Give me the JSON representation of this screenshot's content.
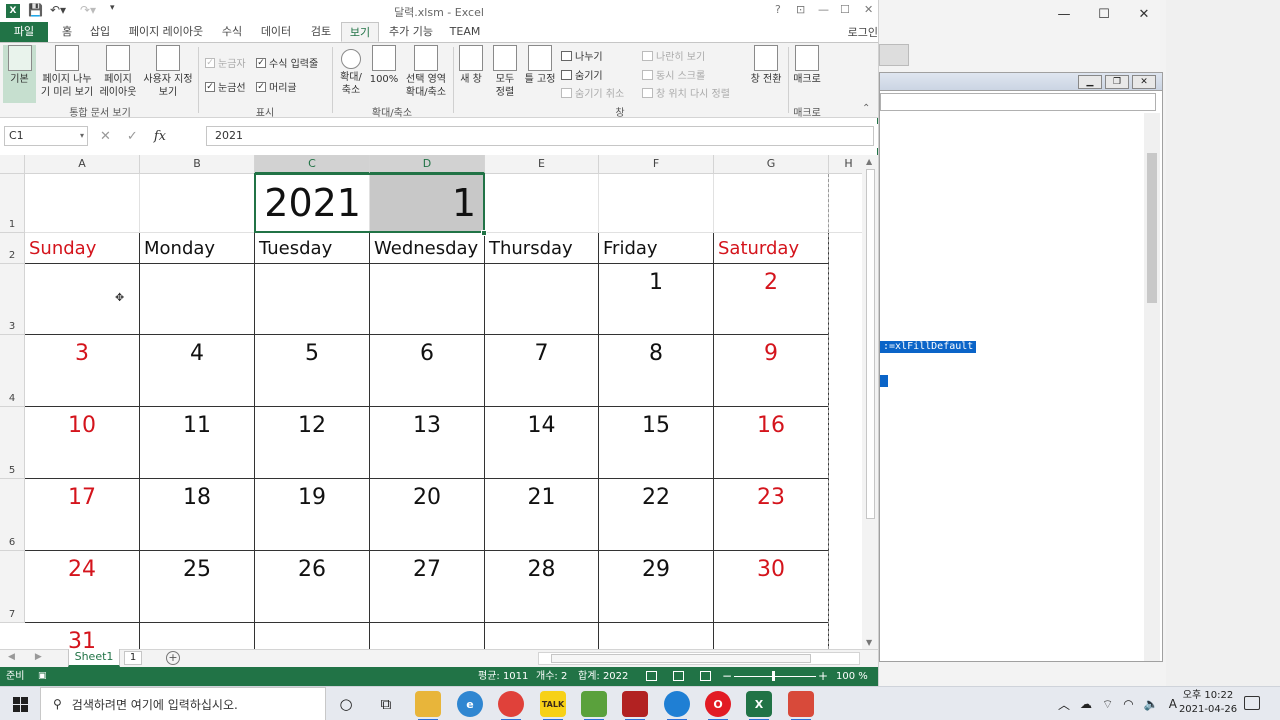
{
  "titlebar": {
    "doc_title": "달력.xlsm - Excel",
    "help": "?",
    "minimize": "—",
    "restore": "☐",
    "close": "✕"
  },
  "tabs": {
    "file": "파일",
    "items": [
      "홈",
      "삽입",
      "페이지 레이아웃",
      "수식",
      "데이터",
      "검토",
      "보기",
      "추가 기능",
      "TEAM"
    ],
    "active": "보기",
    "login": "로그인"
  },
  "ribbon": {
    "workbook_views": {
      "normal": "기본",
      "page_break": "페이지 나누\n기 미리 보기",
      "page_layout": "페이지\n레이아웃",
      "custom_views": "사용자 지정\n보기",
      "group_label": "통합 문서 보기"
    },
    "show": {
      "ruler": "눈금자",
      "formula_bar": "수식 입력줄",
      "gridlines": "눈금선",
      "headings": "머리글",
      "group_label": "표시"
    },
    "zoom": {
      "zoom": "확대/\n축소",
      "hundred": "100%",
      "zoom_selection": "선택 영역\n확대/축소",
      "group_label": "확대/축소"
    },
    "window": {
      "new_window": "새 창",
      "arrange_all": "모두\n정렬",
      "freeze": "틀 고정",
      "split": "나누기",
      "hide": "숨기기",
      "unhide": "숨기기 취소",
      "side_by_side": "나란히 보기",
      "sync_scroll": "동시 스크롤",
      "reset_pos": "창 위치 다시 정렬",
      "switch": "창 전환",
      "group_label": "창"
    },
    "macros": {
      "macros": "매크로",
      "group_label": "매크로"
    }
  },
  "formula_bar": {
    "name_box": "C1",
    "formula": "2021"
  },
  "grid": {
    "columns": [
      "A",
      "B",
      "C",
      "D",
      "E",
      "F",
      "G",
      "H"
    ],
    "rows": [
      "1",
      "2",
      "3",
      "4",
      "5",
      "6",
      "7"
    ],
    "year": "2021",
    "month": "1",
    "weekdays": [
      "Sunday",
      "Monday",
      "Tuesday",
      "Wednesday",
      "Thursday",
      "Friday",
      "Saturday"
    ],
    "weeks": [
      [
        "",
        "",
        "",
        "",
        "",
        "1",
        "2"
      ],
      [
        "3",
        "4",
        "5",
        "6",
        "7",
        "8",
        "9"
      ],
      [
        "10",
        "11",
        "12",
        "13",
        "14",
        "15",
        "16"
      ],
      [
        "17",
        "18",
        "19",
        "20",
        "21",
        "22",
        "23"
      ],
      [
        "24",
        "25",
        "26",
        "27",
        "28",
        "29",
        "30"
      ],
      [
        "31",
        "",
        "",
        "",
        "",
        "",
        ""
      ]
    ],
    "weekend_color": "#d4141c"
  },
  "sheetbar": {
    "sheet": "Sheet1",
    "sheet_num": "1"
  },
  "status": {
    "ready": "준비",
    "average": "평균: 1011",
    "count": "개수: 2",
    "sum": "합계: 2022",
    "zoom": "100 %"
  },
  "vba": {
    "code_selection": ":=xlFillDefault"
  },
  "taskbar": {
    "search_placeholder": "검색하려면 여기에 입력하십시오.",
    "time": "오후 10:22",
    "date": "2021-04-26",
    "ime": "A"
  },
  "colors": {
    "excel_green": "#217346",
    "selection_fill": "#c8c8c8",
    "vba_selection": "#0a64c8"
  }
}
